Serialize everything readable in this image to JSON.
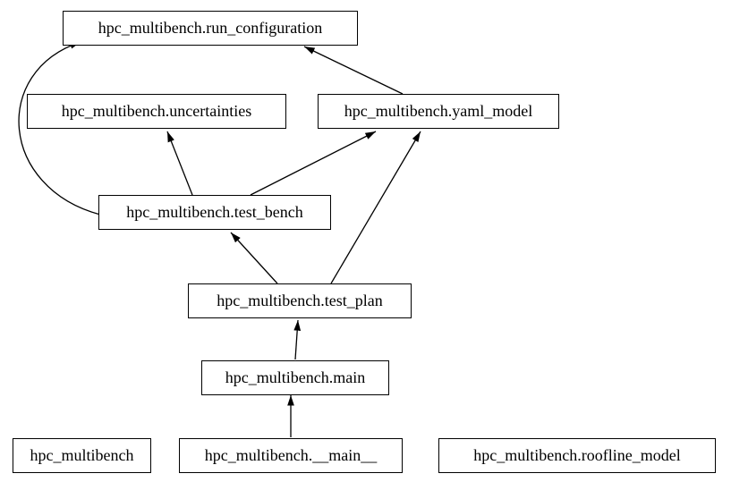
{
  "chart_data": {
    "type": "dependency_graph",
    "title": "",
    "nodes": [
      {
        "id": "run_configuration",
        "label": "hpc_multibench.run_configuration"
      },
      {
        "id": "uncertainties",
        "label": "hpc_multibench.uncertainties"
      },
      {
        "id": "yaml_model",
        "label": "hpc_multibench.yaml_model"
      },
      {
        "id": "test_bench",
        "label": "hpc_multibench.test_bench"
      },
      {
        "id": "test_plan",
        "label": "hpc_multibench.test_plan"
      },
      {
        "id": "main",
        "label": "hpc_multibench.main"
      },
      {
        "id": "pkg",
        "label": "hpc_multibench"
      },
      {
        "id": "dunder_main",
        "label": "hpc_multibench.__main__"
      },
      {
        "id": "roofline_model",
        "label": "hpc_multibench.roofline_model"
      }
    ],
    "edges": [
      {
        "from": "dunder_main",
        "to": "main"
      },
      {
        "from": "main",
        "to": "test_plan"
      },
      {
        "from": "test_plan",
        "to": "test_bench"
      },
      {
        "from": "test_plan",
        "to": "yaml_model"
      },
      {
        "from": "test_bench",
        "to": "uncertainties"
      },
      {
        "from": "test_bench",
        "to": "yaml_model"
      },
      {
        "from": "test_bench",
        "to": "run_configuration"
      },
      {
        "from": "yaml_model",
        "to": "run_configuration"
      }
    ]
  }
}
